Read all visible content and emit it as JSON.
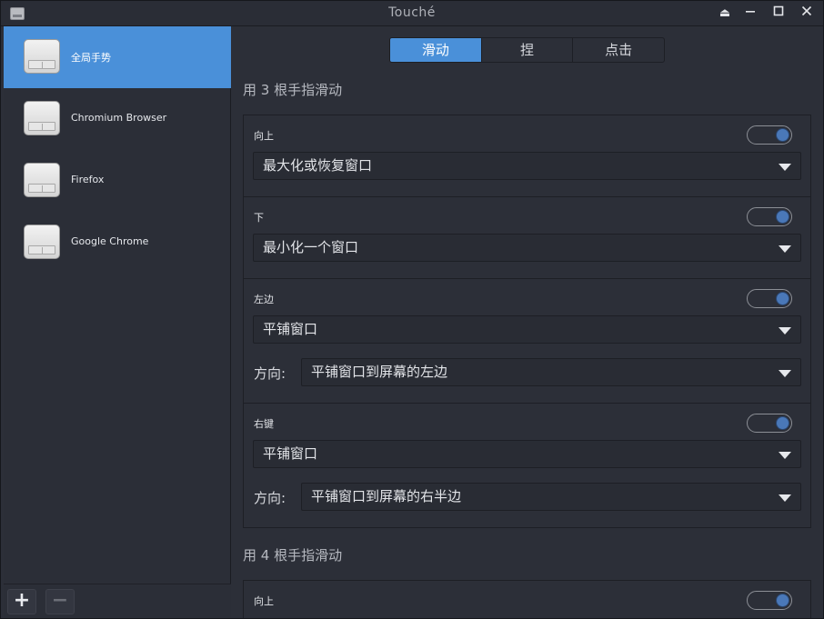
{
  "window": {
    "title": "Touché"
  },
  "sidebar": {
    "items": [
      {
        "label": "全局手势",
        "selected": true
      },
      {
        "label": "Chromium Browser",
        "selected": false
      },
      {
        "label": "Firefox",
        "selected": false
      },
      {
        "label": "Google Chrome",
        "selected": false
      }
    ],
    "add_label": "+",
    "remove_label": "−"
  },
  "tabs": [
    {
      "label": "滑动",
      "active": true
    },
    {
      "label": "捏",
      "active": false
    },
    {
      "label": "点击",
      "active": false
    }
  ],
  "section3": {
    "title": "用 3 根手指滑动",
    "gestures": [
      {
        "label": "向上",
        "enabled": true,
        "action": "最大化或恢复窗口"
      },
      {
        "label": "下",
        "enabled": true,
        "action": "最小化一个窗口"
      },
      {
        "label": "左边",
        "enabled": true,
        "action": "平铺窗口",
        "direction_label": "方向:",
        "direction": "平铺窗口到屏幕的左边"
      },
      {
        "label": "右键",
        "enabled": true,
        "action": "平铺窗口",
        "direction_label": "方向:",
        "direction": "平铺窗口到屏幕的右半边"
      }
    ]
  },
  "section4": {
    "title": "用 4 根手指滑动",
    "gestures": [
      {
        "label": "向上",
        "enabled": true
      }
    ]
  },
  "colors": {
    "accent": "#4a90d9",
    "toggle_knob": "#4a78b8",
    "background": "#2c2f38"
  }
}
